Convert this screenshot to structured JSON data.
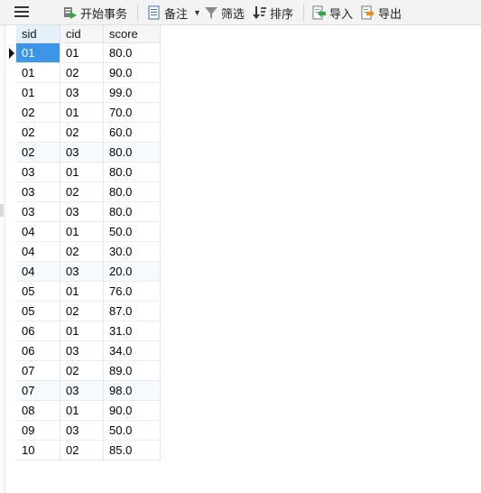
{
  "toolbar": {
    "begin_transaction": "开始事务",
    "memo": "备注",
    "filter": "筛选",
    "sort": "排序",
    "import": "导入",
    "export": "导出"
  },
  "columns": [
    "sid",
    "cid",
    "score"
  ],
  "rows": [
    [
      "01",
      "01",
      "80.0"
    ],
    [
      "01",
      "02",
      "90.0"
    ],
    [
      "01",
      "03",
      "99.0"
    ],
    [
      "02",
      "01",
      "70.0"
    ],
    [
      "02",
      "02",
      "60.0"
    ],
    [
      "02",
      "03",
      "80.0"
    ],
    [
      "03",
      "01",
      "80.0"
    ],
    [
      "03",
      "02",
      "80.0"
    ],
    [
      "03",
      "03",
      "80.0"
    ],
    [
      "04",
      "01",
      "50.0"
    ],
    [
      "04",
      "02",
      "30.0"
    ],
    [
      "04",
      "03",
      "20.0"
    ],
    [
      "05",
      "01",
      "76.0"
    ],
    [
      "05",
      "02",
      "87.0"
    ],
    [
      "06",
      "01",
      "31.0"
    ],
    [
      "06",
      "03",
      "34.0"
    ],
    [
      "07",
      "02",
      "89.0"
    ],
    [
      "07",
      "03",
      "98.0"
    ],
    [
      "08",
      "01",
      "90.0"
    ],
    [
      "09",
      "03",
      "50.0"
    ],
    [
      "10",
      "02",
      "85.0"
    ]
  ],
  "selected_row": 0,
  "alt_rows": [
    5,
    11,
    17
  ]
}
